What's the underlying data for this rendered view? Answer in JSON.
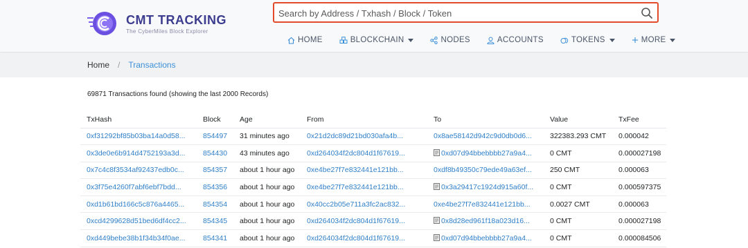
{
  "brand": {
    "title": "CMT TRACKING",
    "subtitle": "The CyberMiles Block Explorer"
  },
  "search": {
    "placeholder": "Search by Address / Txhash / Block / Token"
  },
  "nav": [
    {
      "label": "HOME",
      "icon": "home-icon",
      "dropdown": false
    },
    {
      "label": "BLOCKCHAIN",
      "icon": "cubes-icon",
      "dropdown": true
    },
    {
      "label": "NODES",
      "icon": "share-icon",
      "dropdown": false
    },
    {
      "label": "ACCOUNTS",
      "icon": "user-icon",
      "dropdown": false
    },
    {
      "label": "TOKENS",
      "icon": "coins-icon",
      "dropdown": true
    },
    {
      "label": "MORE",
      "icon": "plus-icon",
      "dropdown": true
    }
  ],
  "breadcrumb": {
    "home": "Home",
    "separator": "/",
    "current": "Transactions"
  },
  "summary": "69871 Transactions found (showing the last 2000 Records)",
  "table": {
    "headers": [
      "TxHash",
      "Block",
      "Age",
      "From",
      "To",
      "Value",
      "TxFee"
    ],
    "rows": [
      {
        "txhash": "0xf31292bf85b03ba14a0d58...",
        "block": "854497",
        "age": "31 minutes ago",
        "from": "0x21d2dc89d21bd030afa4b...",
        "to": "0x8ae58142d942c9d0db0d6...",
        "to_contract": false,
        "value": "322383.293 CMT",
        "fee": "0.000042"
      },
      {
        "txhash": "0x3de0e6b914d4752193a3d...",
        "block": "854430",
        "age": "43 minutes ago",
        "from": "0xd264034f2dc804d1f67619...",
        "to": "0xd07d94bbebbbb27a9a4...",
        "to_contract": true,
        "value": "0 CMT",
        "fee": "0.000027198"
      },
      {
        "txhash": "0x7c4c8f3534af92437edb0c...",
        "block": "854357",
        "age": "about 1 hour ago",
        "from": "0xe4be27f7e832441e121bb...",
        "to": "0xdf8b49350c79ede49a63ef...",
        "to_contract": false,
        "value": "250 CMT",
        "fee": "0.000063"
      },
      {
        "txhash": "0x3f75e4260f7abf6ebf7bdd...",
        "block": "854356",
        "age": "about 1 hour ago",
        "from": "0xe4be27f7e832441e121bb...",
        "to": "0x3a29417c1924d915a60f...",
        "to_contract": true,
        "value": "0 CMT",
        "fee": "0.000597375"
      },
      {
        "txhash": "0xd1b61bd166c5c876a4465...",
        "block": "854354",
        "age": "about 1 hour ago",
        "from": "0x40cc2b05e711a3fc2ac832...",
        "to": "0xe4be27f7e832441e121bb...",
        "to_contract": false,
        "value": "0.0027 CMT",
        "fee": "0.000063"
      },
      {
        "txhash": "0xcd4299628d51bed6df4cc2...",
        "block": "854345",
        "age": "about 1 hour ago",
        "from": "0xd264034f2dc804d1f67619...",
        "to": "0x8d28ed961f18a023d16...",
        "to_contract": true,
        "value": "0 CMT",
        "fee": "0.000027198"
      },
      {
        "txhash": "0xd449bebe38b1f34b34f0ae...",
        "block": "854341",
        "age": "about 1 hour ago",
        "from": "0xd264034f2dc804d1f67619...",
        "to": "0xd07d94bbebbbb27a9a4...",
        "to_contract": true,
        "value": "0 CMT",
        "fee": "0.000084506"
      }
    ]
  },
  "colors": {
    "link": "#2f7fc8",
    "search_border": "#e24a2a",
    "brand": "#3d3d8f",
    "logo_accent": "#7b5cf0"
  }
}
